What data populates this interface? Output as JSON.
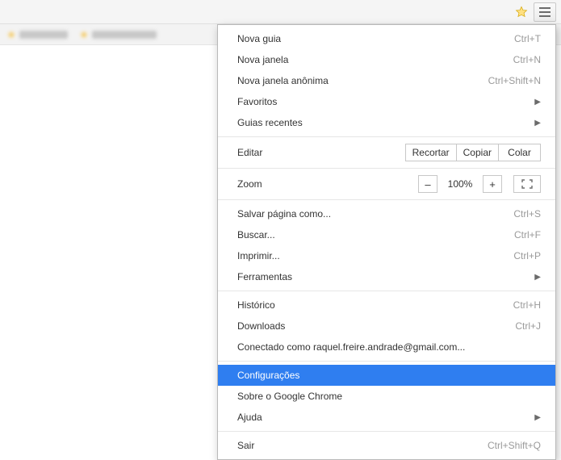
{
  "toolbar": {
    "star": "star-icon",
    "menu": "hamburger-icon"
  },
  "menu": {
    "new_tab": {
      "label": "Nova guia",
      "shortcut": "Ctrl+T"
    },
    "new_window": {
      "label": "Nova janela",
      "shortcut": "Ctrl+N"
    },
    "new_incognito": {
      "label": "Nova janela anônima",
      "shortcut": "Ctrl+Shift+N"
    },
    "bookmarks": {
      "label": "Favoritos"
    },
    "recent_tabs": {
      "label": "Guias recentes"
    },
    "edit": {
      "label": "Editar",
      "cut": "Recortar",
      "copy": "Copiar",
      "paste": "Colar"
    },
    "zoom": {
      "label": "Zoom",
      "minus": "–",
      "value": "100%",
      "plus": "+"
    },
    "save_as": {
      "label": "Salvar página como...",
      "shortcut": "Ctrl+S"
    },
    "find": {
      "label": "Buscar...",
      "shortcut": "Ctrl+F"
    },
    "print": {
      "label": "Imprimir...",
      "shortcut": "Ctrl+P"
    },
    "tools": {
      "label": "Ferramentas"
    },
    "history": {
      "label": "Histórico",
      "shortcut": "Ctrl+H"
    },
    "downloads": {
      "label": "Downloads",
      "shortcut": "Ctrl+J"
    },
    "signed_in": {
      "label": "Conectado como raquel.freire.andrade@gmail.com..."
    },
    "settings": {
      "label": "Configurações"
    },
    "about": {
      "label": "Sobre o Google Chrome"
    },
    "help": {
      "label": "Ajuda"
    },
    "exit": {
      "label": "Sair",
      "shortcut": "Ctrl+Shift+Q"
    }
  }
}
